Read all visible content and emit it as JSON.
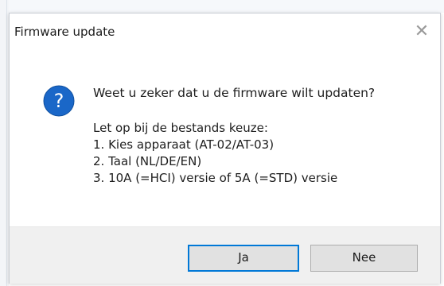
{
  "dialog": {
    "title": "Firmware update",
    "close_glyph": "✕",
    "icon": "question-icon",
    "main_instruction": "Weet u zeker dat u de firmware wilt updaten?",
    "details": [
      "Let op bij de bestands keuze:",
      "1. Kies apparaat (AT-02/AT-03)",
      "2. Taal (NL/DE/EN)",
      "3. 10A (=HCI) versie of 5A (=STD) versie"
    ],
    "buttons": {
      "yes_label": "Ja",
      "no_label": "Nee"
    }
  },
  "colors": {
    "icon_blue": "#1a67c8",
    "focus_border": "#0078d7",
    "footer_bg": "#f0f0f0"
  }
}
